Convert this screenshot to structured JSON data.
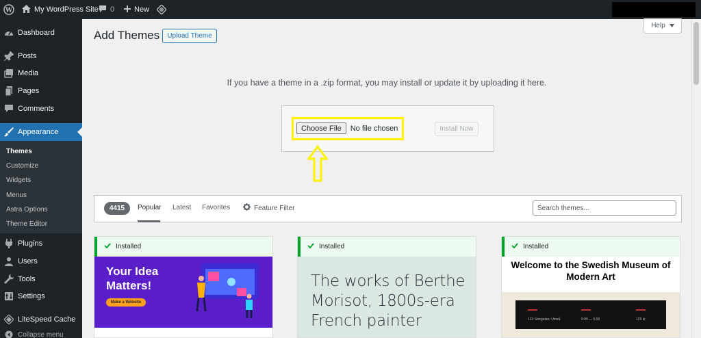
{
  "admin_bar": {
    "site_name": "My WordPress Site",
    "comments_count": "0",
    "new_label": "New"
  },
  "sidebar": {
    "items": [
      {
        "label": "Dashboard",
        "icon": "dashboard-icon"
      },
      {
        "label": "Posts",
        "icon": "pin-icon"
      },
      {
        "label": "Media",
        "icon": "media-icon"
      },
      {
        "label": "Pages",
        "icon": "pages-icon"
      },
      {
        "label": "Comments",
        "icon": "comment-icon"
      },
      {
        "label": "Appearance",
        "icon": "brush-icon",
        "current": true
      },
      {
        "label": "Plugins",
        "icon": "plug-icon"
      },
      {
        "label": "Users",
        "icon": "user-icon"
      },
      {
        "label": "Tools",
        "icon": "wrench-icon"
      },
      {
        "label": "Settings",
        "icon": "settings-icon"
      },
      {
        "label": "LiteSpeed Cache",
        "icon": "diamond-icon"
      }
    ],
    "submenu": [
      "Themes",
      "Customize",
      "Widgets",
      "Menus",
      "Astra Options",
      "Theme Editor"
    ],
    "collapse_label": "Collapse menu"
  },
  "page": {
    "title": "Add Themes",
    "upload_button": "Upload Theme",
    "help_button": "Help"
  },
  "upload": {
    "description": "If you have a theme in a .zip format, you may install or update it by uploading it here.",
    "choose_file": "Choose File",
    "no_file": "No file chosen",
    "install_now": "Install Now",
    "highlight_color": "#fff200"
  },
  "filter": {
    "count": "4415",
    "tabs": [
      "Popular",
      "Latest",
      "Favorites"
    ],
    "feature_filter": "Feature Filter",
    "search_placeholder": "Search themes..."
  },
  "themes": [
    {
      "status": "Installed",
      "headline": "Your Idea Matters!",
      "cta": "Make a Website"
    },
    {
      "status": "Installed",
      "headline": "The works of Berthe Morisot, 1800s-era French painter"
    },
    {
      "status": "Installed",
      "headline": "Welcome to the Swedish Museum of Modern Art",
      "band": [
        "123 Storgatan, Umeå",
        "9:00 — 5:00",
        "129 kr"
      ]
    }
  ],
  "colors": {
    "admin_bar_bg": "#1d2327",
    "accent_blue": "#2271b1",
    "installed_green": "#00a32a"
  }
}
